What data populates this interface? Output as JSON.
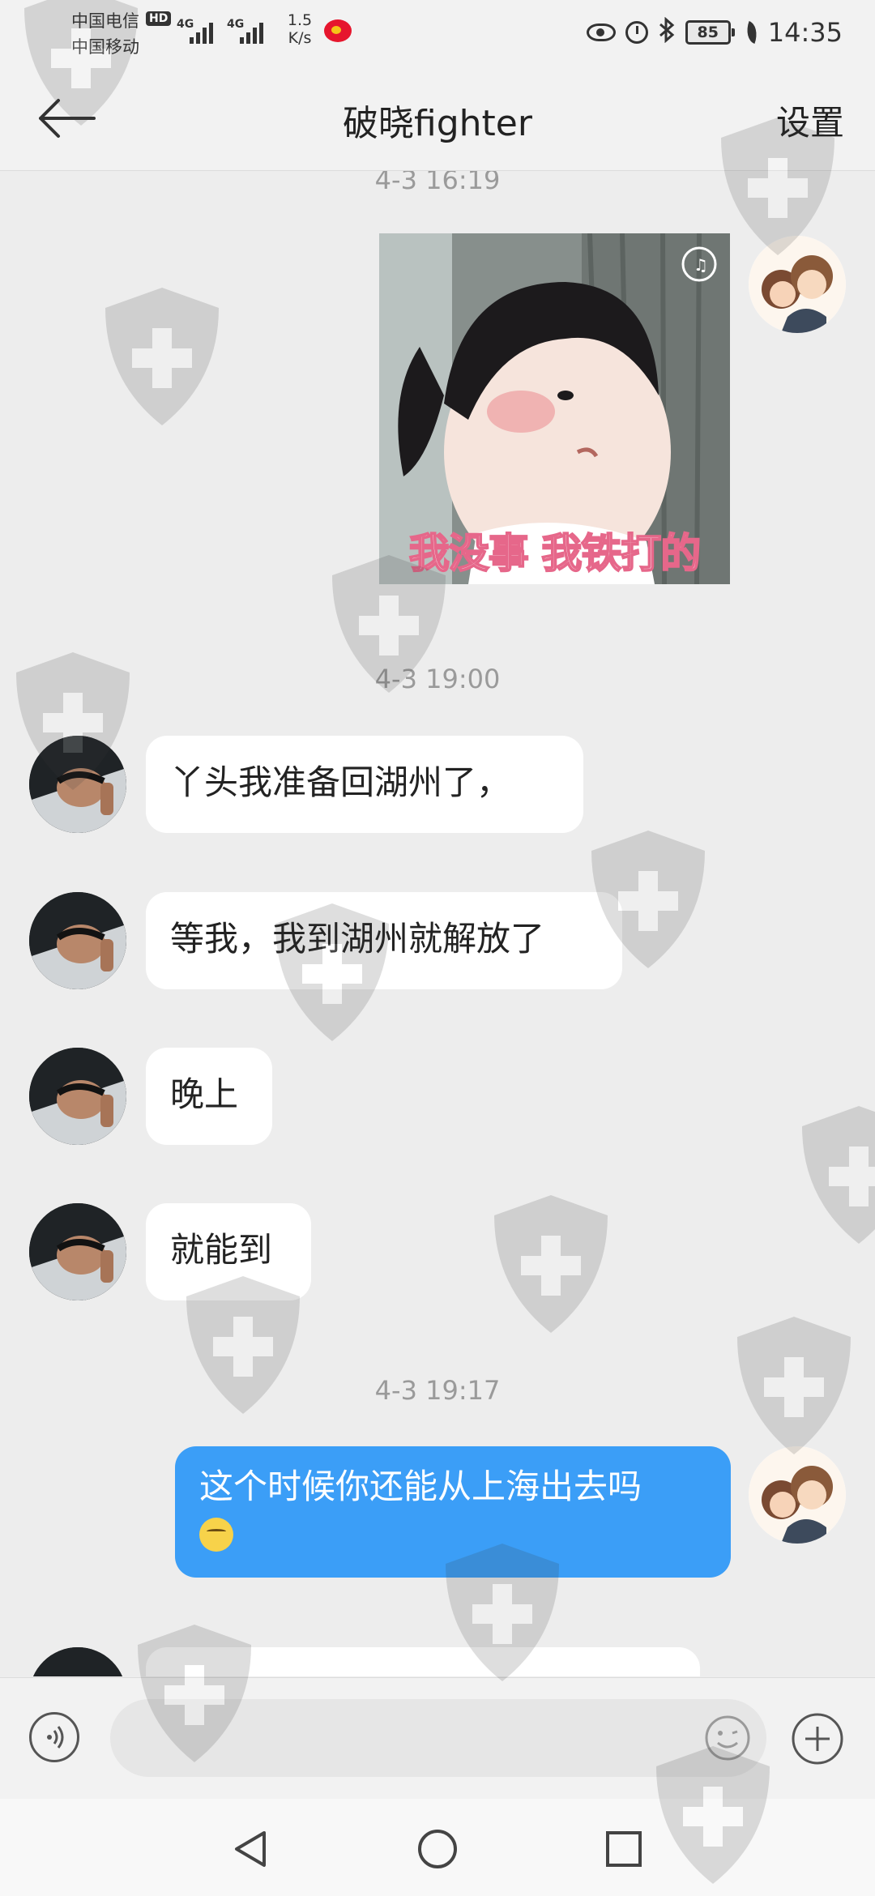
{
  "status_bar": {
    "carrier_1": "中国电信",
    "carrier_2": "中国移动",
    "hd_badge": "HD",
    "signal_1_type": "4G",
    "signal_2_type": "4G",
    "net_speed_value": "1.5",
    "net_speed_unit": "K/s",
    "battery_level": "85",
    "time": "14:35",
    "icons": [
      "weibo-icon",
      "eye-icon",
      "alarm-icon",
      "bluetooth-icon",
      "battery-icon",
      "leaf-icon"
    ]
  },
  "header": {
    "title": "破晓fighter",
    "settings_label": "设置"
  },
  "chat": {
    "timestamps": [
      "4-3 16:19",
      "4-3 19:00",
      "4-3 19:17"
    ],
    "sticker_caption": "我没事 我铁打的",
    "messages": [
      {
        "sender": "other",
        "text": "丫头我准备回湖州了，"
      },
      {
        "sender": "other",
        "text": "等我，我到湖州就解放了"
      },
      {
        "sender": "other",
        "text": "晚上"
      },
      {
        "sender": "other",
        "text": "就能到"
      },
      {
        "sender": "me",
        "text": "这个时候你还能从上海出去吗"
      }
    ]
  },
  "input_bar": {
    "placeholder": "",
    "value": ""
  },
  "colors": {
    "outgoing_bubble": "#3b9ef7",
    "incoming_bubble": "#ffffff",
    "chat_background": "#ededed",
    "timestamp_text": "#9a9a9a"
  }
}
